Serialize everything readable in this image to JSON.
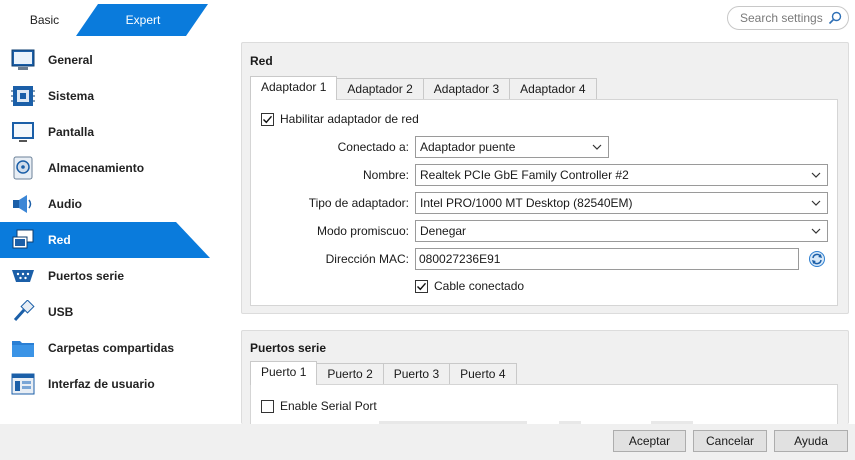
{
  "mode": {
    "basic": "Basic",
    "expert": "Expert"
  },
  "search": {
    "placeholder": "Search settings"
  },
  "sidebar": {
    "items": [
      {
        "label": "General",
        "icon": "general-icon"
      },
      {
        "label": "Sistema",
        "icon": "system-icon"
      },
      {
        "label": "Pantalla",
        "icon": "display-icon"
      },
      {
        "label": "Almacenamiento",
        "icon": "storage-icon"
      },
      {
        "label": "Audio",
        "icon": "audio-icon"
      },
      {
        "label": "Red",
        "icon": "network-icon",
        "active": true
      },
      {
        "label": "Puertos serie",
        "icon": "serial-ports-icon"
      },
      {
        "label": "USB",
        "icon": "usb-icon"
      },
      {
        "label": "Carpetas compartidas",
        "icon": "shared-folders-icon"
      },
      {
        "label": "Interfaz de usuario",
        "icon": "user-interface-icon"
      }
    ]
  },
  "network": {
    "title": "Red",
    "tabs": [
      "Adaptador 1",
      "Adaptador 2",
      "Adaptador 3",
      "Adaptador 4"
    ],
    "enable_label": "Habilitar adaptador de red",
    "enable_checked": true,
    "attached_label": "Conectado a:",
    "attached_value": "Adaptador puente",
    "name_label": "Nombre:",
    "name_value": "Realtek PCIe GbE Family Controller #2",
    "adapter_type_label": "Tipo de adaptador:",
    "adapter_type_value": "Intel PRO/1000 MT Desktop (82540EM)",
    "promiscuous_label": "Modo promiscuo:",
    "promiscuous_value": "Denegar",
    "mac_label": "Dirección MAC:",
    "mac_value": "080027236E91",
    "cable_label": "Cable conectado",
    "cable_checked": true
  },
  "serial": {
    "title": "Puertos serie",
    "tabs": [
      "Puerto 1",
      "Puerto 2",
      "Puerto 3",
      "Puerto 4"
    ],
    "enable_label": "Enable Serial Port",
    "enable_checked": false
  },
  "footer": {
    "ok": "Aceptar",
    "cancel": "Cancelar",
    "help": "Ayuda"
  },
  "colors": {
    "accent": "#0a7bdc",
    "accent_dark": "#0868c0"
  }
}
